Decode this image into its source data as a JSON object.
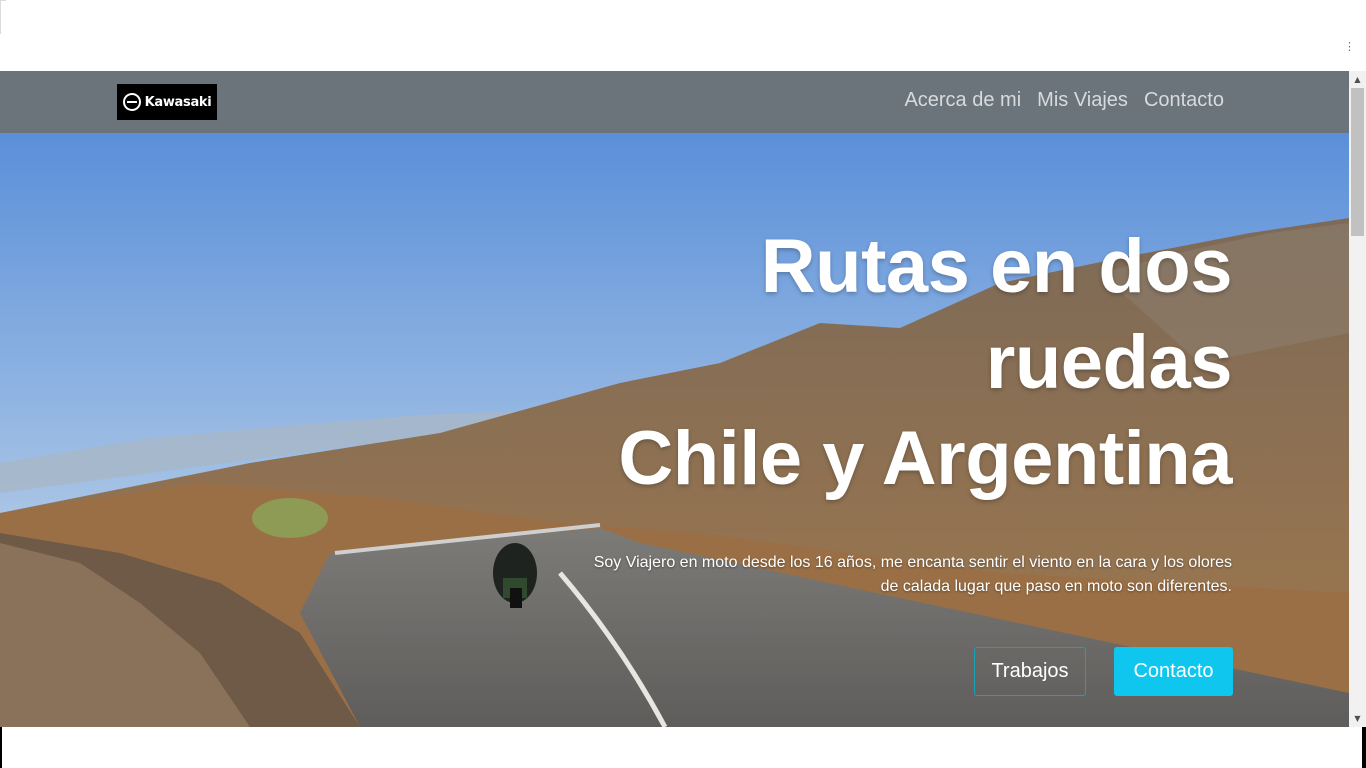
{
  "navbar": {
    "logo_text": "Kawasaki",
    "links": [
      "Acerca de mi",
      "Mis Viajes",
      "Contacto"
    ]
  },
  "hero": {
    "title_lines": [
      "Rutas en dos",
      "ruedas",
      "Chile y Argentina"
    ],
    "subtitle": "Soy Viajero en moto desde los 16 años, me encanta sentir el viento en la cara y los olores de calada lugar que paso en moto son diferentes.",
    "btn_outline": "Trabajos",
    "btn_primary": "Contacto"
  },
  "colors": {
    "navbar_bg": "#6b737b",
    "primary": "#0fc6ee",
    "outline_border": "#17a2b8"
  },
  "icons": {
    "menu": "kebab-menu-icon",
    "scroll_up": "scroll-up-arrow-icon",
    "scroll_down": "scroll-down-arrow-icon",
    "logo": "kawasaki-logo-icon"
  }
}
